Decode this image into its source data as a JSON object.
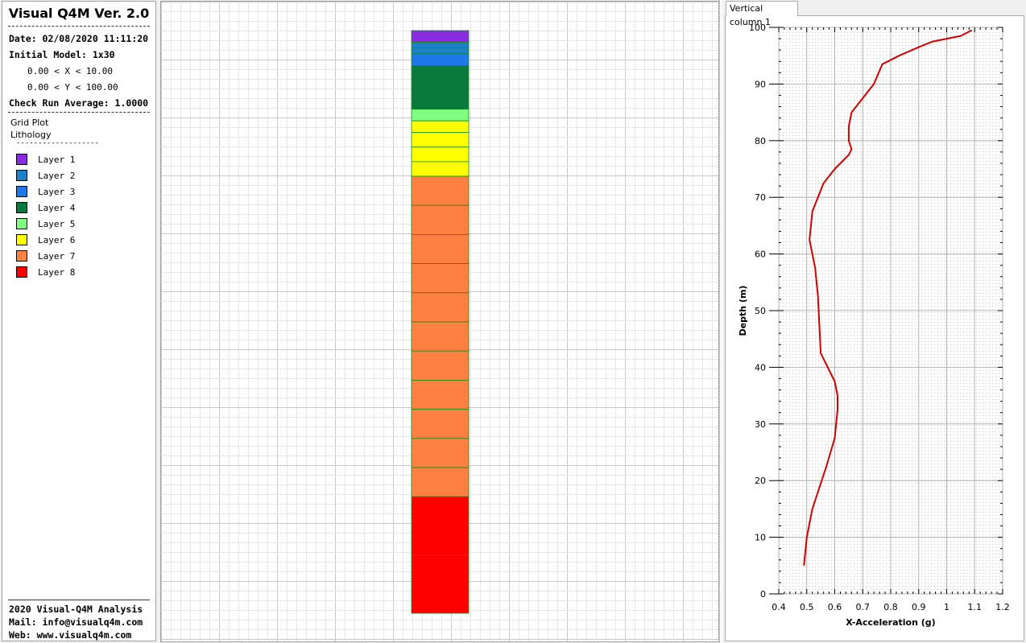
{
  "app": {
    "title": "Visual Q4M Ver. 2.0"
  },
  "info": {
    "date": "Date: 02/08/2020 11:11:20",
    "initial_model": "Initial Model: 1x30",
    "x_range": "0.00 < X < 10.00",
    "y_range": "0.00 < Y < 100.00",
    "check_run": "Check Run Average: 1.0000"
  },
  "plot_info": {
    "grid_plot": "Grid Plot",
    "lithology": "Lithology",
    "divider": "-------------------"
  },
  "legend": [
    {
      "label": "Layer 1",
      "color": "#8a2be2"
    },
    {
      "label": "Layer 2",
      "color": "#1a82c8"
    },
    {
      "label": "Layer 3",
      "color": "#1e78e6"
    },
    {
      "label": "Layer 4",
      "color": "#0a7a3c"
    },
    {
      "label": "Layer 5",
      "color": "#80ff80"
    },
    {
      "label": "Layer 6",
      "color": "#ffff00"
    },
    {
      "label": "Layer 7",
      "color": "#ff8040"
    },
    {
      "label": "Layer 8",
      "color": "#ff0000"
    }
  ],
  "footer": {
    "line1": "2020 Visual-Q4M Analysis",
    "line2": "Mail: info@visualq4m.com",
    "line3": "Web: www.visualq4m.com"
  },
  "column_model": {
    "y_top": 100,
    "y_bottom": 0,
    "cells": [
      {
        "top": 100,
        "bottom": 98,
        "layer": 1
      },
      {
        "top": 98,
        "bottom": 97,
        "layer": 2
      },
      {
        "top": 97,
        "bottom": 96,
        "layer": 2
      },
      {
        "top": 96,
        "bottom": 94,
        "layer": 3
      },
      {
        "top": 94,
        "bottom": 86.5,
        "layer": 4
      },
      {
        "top": 86.5,
        "bottom": 84.5,
        "layer": 5
      },
      {
        "top": 84.5,
        "bottom": 82.5,
        "layer": 6
      },
      {
        "top": 82.5,
        "bottom": 80,
        "layer": 6
      },
      {
        "top": 80,
        "bottom": 77.5,
        "layer": 6
      },
      {
        "top": 77.5,
        "bottom": 75,
        "layer": 6
      },
      {
        "top": 75,
        "bottom": 70,
        "layer": 7
      },
      {
        "top": 70,
        "bottom": 65,
        "layer": 7
      },
      {
        "top": 65,
        "bottom": 60,
        "layer": 7
      },
      {
        "top": 60,
        "bottom": 55,
        "layer": 7
      },
      {
        "top": 55,
        "bottom": 50,
        "layer": 7
      },
      {
        "top": 50,
        "bottom": 45,
        "layer": 7
      },
      {
        "top": 45,
        "bottom": 40,
        "layer": 7
      },
      {
        "top": 40,
        "bottom": 35,
        "layer": 7
      },
      {
        "top": 35,
        "bottom": 30,
        "layer": 7
      },
      {
        "top": 30,
        "bottom": 25,
        "layer": 7
      },
      {
        "top": 25,
        "bottom": 20,
        "layer": 7
      },
      {
        "top": 20,
        "bottom": 10,
        "layer": 8
      },
      {
        "top": 10,
        "bottom": 0,
        "layer": 8
      }
    ]
  },
  "right_panel": {
    "tab_label": "Vertical column 1"
  },
  "chart_data": {
    "type": "line",
    "title": "",
    "xlabel": "X-Acceleration (g)",
    "ylabel": "Depth (m)",
    "xlim": [
      0.4,
      1.2
    ],
    "ylim": [
      0,
      100
    ],
    "x_ticks": [
      "0.4",
      "0.5",
      "0.6",
      "0.7",
      "0.8",
      "0.9",
      "1",
      "1.1",
      "1.2"
    ],
    "y_ticks": [
      "0",
      "10",
      "20",
      "30",
      "40",
      "50",
      "60",
      "70",
      "80",
      "90",
      "100"
    ],
    "grid": true,
    "series_color": "#cc0000",
    "series": [
      {
        "x": [
          0.49,
          0.5,
          0.52,
          0.57,
          0.6,
          0.61,
          0.61,
          0.6,
          0.55,
          0.545,
          0.54,
          0.53,
          0.51,
          0.52,
          0.56,
          0.6,
          0.65,
          0.66,
          0.65,
          0.65,
          0.66,
          0.7,
          0.74,
          0.77,
          0.83,
          0.9,
          0.95,
          1.05,
          1.09
        ],
        "y": [
          5,
          10,
          15,
          22.5,
          27.5,
          32.5,
          35,
          37.5,
          42.5,
          47.5,
          52.5,
          57.5,
          62.5,
          67.5,
          72.5,
          75,
          77.5,
          78.5,
          80,
          82.5,
          85,
          87.5,
          90,
          93.5,
          95,
          96.5,
          97.5,
          98.5,
          99.5
        ]
      }
    ]
  }
}
